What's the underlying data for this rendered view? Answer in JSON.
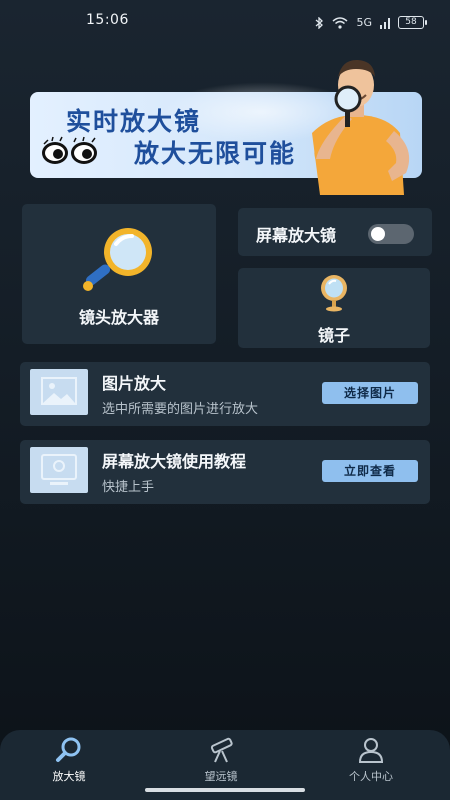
{
  "status_bar": {
    "time": "15:06",
    "signal_text": "5G",
    "battery": "58"
  },
  "banner": {
    "title": "实时放大镜",
    "subtitle": "放大无限可能"
  },
  "features": {
    "lens_magnifier": {
      "label": "镜头放大器",
      "icon": "magnifier-icon"
    },
    "screen_magnifier": {
      "label": "屏幕放大镜",
      "toggle_on": false
    },
    "mirror": {
      "label": "镜子",
      "icon": "mirror-icon"
    }
  },
  "rows": [
    {
      "title": "图片放大",
      "subtitle": "选中所需要的图片进行放大",
      "button": "选择图片",
      "icon": "image-icon"
    },
    {
      "title": "屏幕放大镜使用教程",
      "subtitle": "快捷上手",
      "button": "立即查看",
      "icon": "monitor-icon"
    }
  ],
  "bottom_nav": [
    {
      "label": "放大镜",
      "icon": "magnifier-icon",
      "active": true
    },
    {
      "label": "望远镜",
      "icon": "telescope-icon",
      "active": false
    },
    {
      "label": "个人中心",
      "icon": "person-icon",
      "active": false
    }
  ],
  "colors": {
    "background": "#141d26",
    "card": "#22303c",
    "accent_button": "#8fbfee",
    "banner_text": "#1f4f9c"
  }
}
